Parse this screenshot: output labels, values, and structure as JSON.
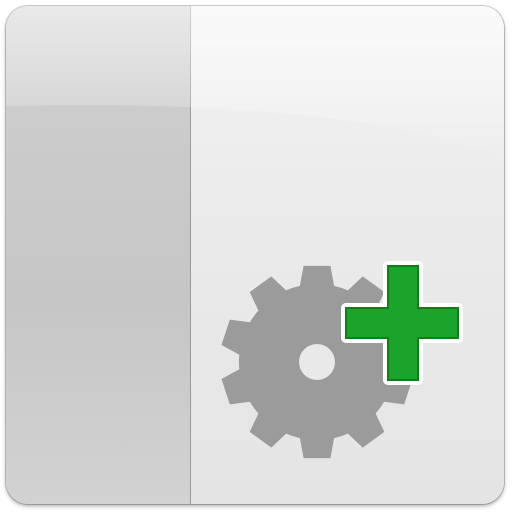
{
  "icon": {
    "name": "add-settings-panel-icon",
    "elements": [
      "left-panel",
      "right-panel",
      "gear-icon",
      "plus-icon"
    ],
    "colors": {
      "gear": "#9b9b9b",
      "plus_fill": "#1aa52a",
      "plus_stroke": "#0e7f1b",
      "left_panel": "#c9c9c9",
      "right_panel": "#ececec",
      "divider": "#9a9a9a"
    }
  }
}
